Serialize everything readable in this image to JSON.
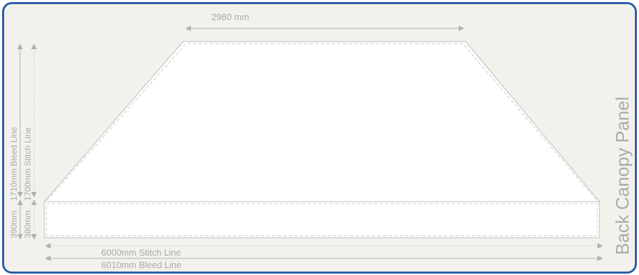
{
  "colors": {
    "border": "#2a5fa8",
    "background": "#f3f1ec",
    "panel_fill": "#ffffff",
    "line": "#b8b8b8",
    "dashed_line": "#c8c8c8",
    "text": "#aaaaaa"
  },
  "panel_title": "Back Canopy Panel",
  "dimensions": {
    "top_width": "2980 mm",
    "stitch_width": "6000mm Stitch Line",
    "bleed_width": "6010mm Bleed Line",
    "height_bleed_upper": "1710mm Bleed Line",
    "height_stitch_upper": "1700mm Stitch Line",
    "height_bleed_lower": "390mm",
    "height_stitch_lower": "380mm"
  }
}
